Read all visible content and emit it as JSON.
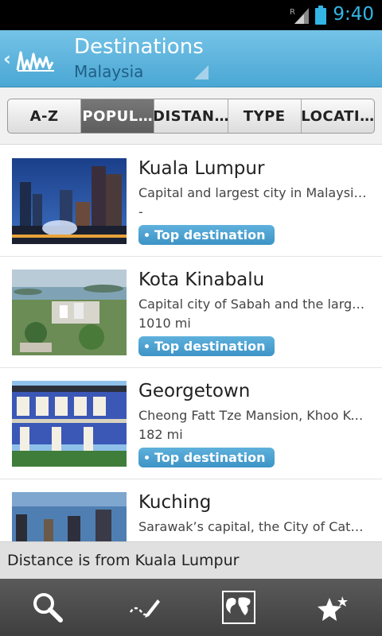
{
  "status_bar": {
    "time": "9:40",
    "roaming": "R"
  },
  "header": {
    "title": "Destinations",
    "subtitle": "Malaysia",
    "back_icon": "chevron-left-icon",
    "logo_icon": "skyline-logo-icon"
  },
  "tabs": [
    {
      "label": "A-Z",
      "active": false
    },
    {
      "label": "POPUL…",
      "active": true
    },
    {
      "label": "DISTAN…",
      "active": false
    },
    {
      "label": "TYPE",
      "active": false
    },
    {
      "label": "LOCATI…",
      "active": false
    }
  ],
  "destinations": [
    {
      "name": "Kuala Lumpur",
      "description": "Capital and largest city in Malaysi…",
      "distance": "-",
      "badge": "Top destination"
    },
    {
      "name": "Kota Kinabalu",
      "description": "Capital city of Sabah and the large…",
      "distance": "1010 mi",
      "badge": "Top destination"
    },
    {
      "name": "Georgetown",
      "description": "Cheong Fatt Tze Mansion, Khoo Ko…",
      "distance": "182 mi",
      "badge": "Top destination"
    },
    {
      "name": "Kuching",
      "description": "Sarawak’s capital, the City of Cats i…",
      "distance": "",
      "badge": ""
    }
  ],
  "footer_note": "Distance is from Kuala Lumpur",
  "bottom_bar": [
    {
      "icon": "search-icon"
    },
    {
      "icon": "phrasebook-pen-icon"
    },
    {
      "icon": "world-map-icon"
    },
    {
      "icon": "favorites-stars-icon"
    }
  ],
  "colors": {
    "accent": "#4aa7d4",
    "clock": "#33b5e5",
    "badge": "#3d93c6"
  }
}
